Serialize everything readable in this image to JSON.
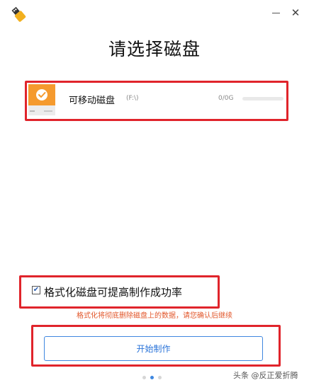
{
  "window": {
    "minimize_glyph": "",
    "close_glyph": "✕"
  },
  "page": {
    "title": "请选择磁盘"
  },
  "disk": {
    "name": "可移动磁盘",
    "path": "(F:\\)",
    "size": "0/0G",
    "used_fraction": 0,
    "selected": true
  },
  "options": {
    "format_label": "格式化磁盘可提高制作成功率",
    "format_checked": true,
    "warning": "格式化将彻底删除磁盘上的数据，请您确认后继续"
  },
  "actions": {
    "start_label": "开始制作"
  },
  "pager": {
    "count": 3,
    "active_index": 1
  },
  "watermark": {
    "text": "头条 @反正爱折腾"
  },
  "colors": {
    "accent": "#3f87e0",
    "highlight_red": "#e0242b",
    "disk_orange": "#f59a2e",
    "warning_text": "#e2572b"
  },
  "icons": {
    "app_logo": "usb-stick-icon",
    "disk": "removable-disk-icon",
    "check": "checkmark-icon"
  }
}
